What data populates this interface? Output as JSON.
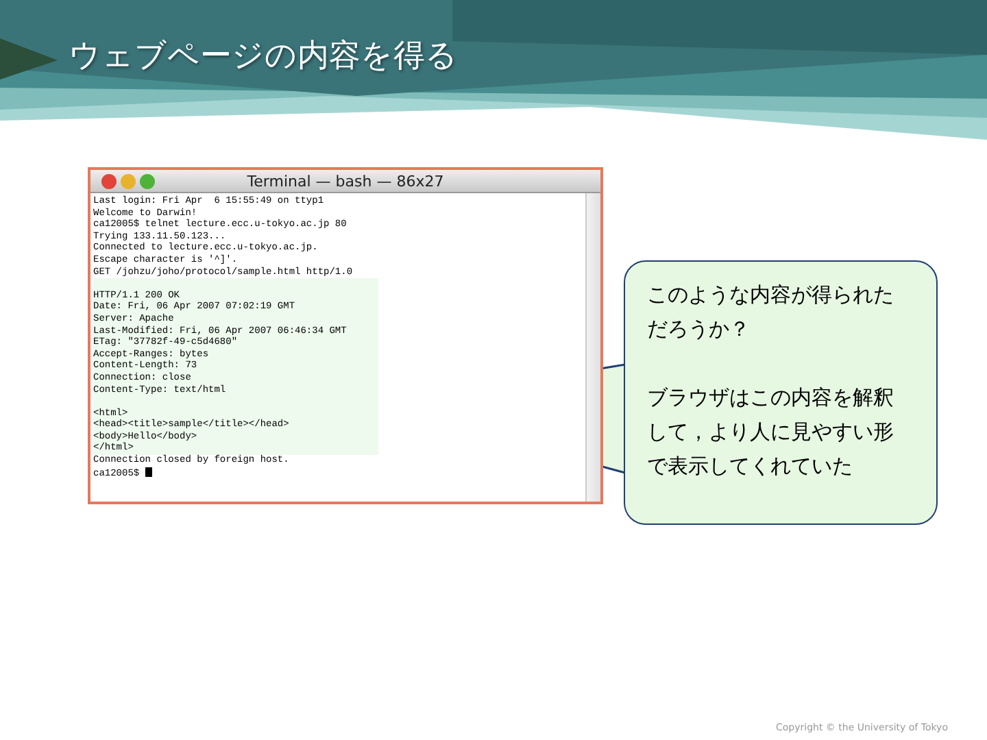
{
  "slide_title": "ウェブページの内容を得る",
  "terminal": {
    "title": "Terminal — bash — 86x27",
    "sections": [
      {
        "highlighted": false,
        "spaced": false,
        "lines": [
          "Last login: Fri Apr  6 15:55:49 on ttyp1",
          "Welcome to Darwin!",
          "ca12005$ telnet lecture.ecc.u-tokyo.ac.jp 80",
          "Trying 133.11.50.123...",
          "Connected to lecture.ecc.u-tokyo.ac.jp.",
          "Escape character is '^]'.",
          "GET /johzu/joho/protocol/sample.html http/1.0"
        ]
      },
      {
        "highlighted": true,
        "spaced": true,
        "lines": [
          "HTTP/1.1 200 OK",
          "Date: Fri, 06 Apr 2007 07:02:19 GMT",
          "Server: Apache",
          "Last-Modified: Fri, 06 Apr 2007 06:46:34 GMT",
          "ETag: \"37782f-49-c5d4680\"",
          "Accept-Ranges: bytes",
          "Content-Length: 73",
          "Connection: close",
          "Content-Type: text/html"
        ]
      },
      {
        "highlighted": true,
        "spaced": true,
        "lines": [
          "<html>",
          "<head><title>sample</title></head>",
          "<body>Hello</body>",
          "</html>"
        ]
      },
      {
        "highlighted": false,
        "spaced": false,
        "lines": [
          "Connection closed by foreign host.",
          "ca12005$"
        ]
      }
    ]
  },
  "callout": {
    "paragraphs": [
      "このような内容が得られただろうか？",
      "ブラウザはこの内容を解釈して，より人に見やすい形で表示してくれていた"
    ]
  },
  "footer": "Copyright © the University of Tokyo"
}
